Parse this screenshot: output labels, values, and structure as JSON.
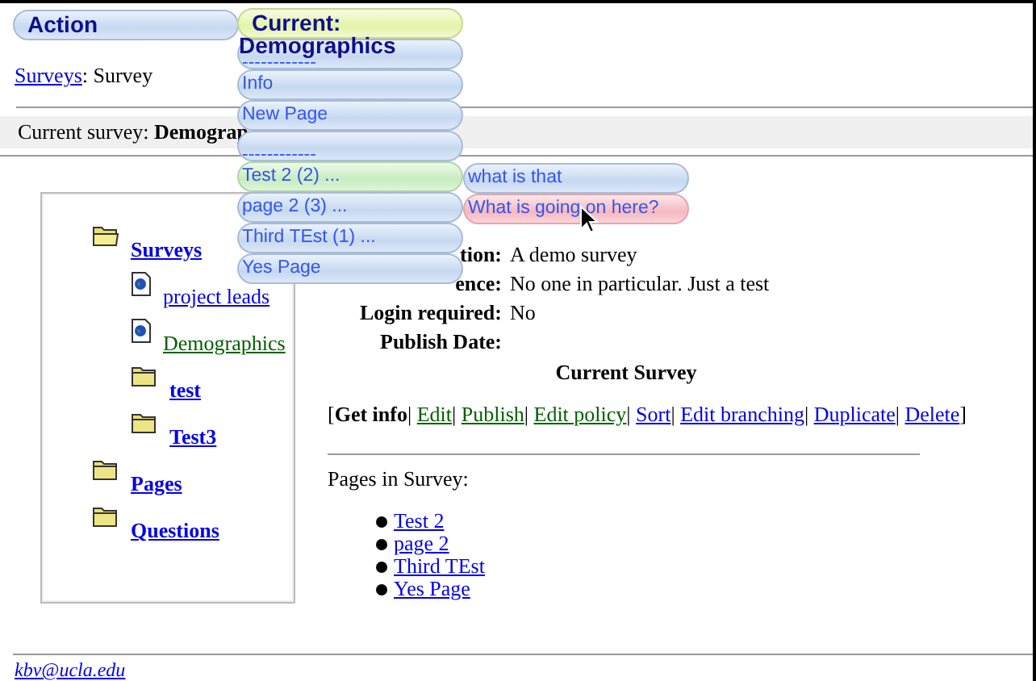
{
  "menubar": [
    {
      "label": "Action"
    }
  ],
  "current_menu": {
    "title": "Current:",
    "subtitle": "Demographics",
    "items": [
      {
        "label": "------------",
        "kind": "separator",
        "expanded": false
      },
      {
        "label": "Info",
        "kind": "item",
        "expanded": false
      },
      {
        "label": "New Page",
        "kind": "item",
        "expanded": false
      },
      {
        "label": "------------",
        "kind": "separator",
        "expanded": false
      },
      {
        "label": "Test 2 (2) ...",
        "kind": "item",
        "expanded": true
      },
      {
        "label": "page 2 (3) ...",
        "kind": "item",
        "expanded": false
      },
      {
        "label": "Third TEst (1) ...",
        "kind": "item",
        "expanded": false
      },
      {
        "label": "Yes Page",
        "kind": "item",
        "expanded": false
      }
    ]
  },
  "submenu": [
    {
      "label": "what is that",
      "selected": false
    },
    {
      "label": "What is going on here?",
      "selected": true
    }
  ],
  "breadcrumb": {
    "link": "Surveys",
    "rest": ": Survey"
  },
  "current_survey": {
    "label": "Current survey: ",
    "value": "Demograp"
  },
  "tree": [
    {
      "label": "Surveys",
      "kind": "folder",
      "expanded": true,
      "selected": false,
      "children": [
        {
          "label": "project leads",
          "kind": "page",
          "selected": false
        },
        {
          "label": "Demographics",
          "kind": "page",
          "selected": true
        },
        {
          "label": "test",
          "kind": "folder",
          "expanded": false,
          "selected": false
        },
        {
          "label": "Test3",
          "kind": "folder",
          "expanded": false,
          "selected": false
        }
      ]
    },
    {
      "label": "Pages",
      "kind": "folder",
      "expanded": false,
      "selected": false
    },
    {
      "label": "Questions",
      "kind": "folder",
      "expanded": false,
      "selected": false
    }
  ],
  "details": [
    {
      "label": "tion:",
      "value": "A demo survey"
    },
    {
      "label": "ence:",
      "value": "No one in particular. Just a test"
    },
    {
      "label": "Login required:",
      "value": "No"
    },
    {
      "label": "Publish Date:"
    }
  ],
  "heading": "Current Survey",
  "actions": {
    "open": "[",
    "close": "]",
    "separator": "|",
    "items": [
      {
        "label": "Get info",
        "kind": "current"
      },
      {
        "label": "Edit",
        "kind": "link",
        "visited": true
      },
      {
        "label": "Publish",
        "kind": "link",
        "visited": true
      },
      {
        "label": "Edit policy",
        "kind": "link",
        "visited": true
      },
      {
        "label": "Sort",
        "kind": "link",
        "visited": false
      },
      {
        "label": "Edit branching",
        "kind": "link",
        "visited": false
      },
      {
        "label": "Duplicate",
        "kind": "link",
        "visited": false
      },
      {
        "label": "Delete",
        "kind": "link",
        "visited": false
      }
    ]
  },
  "pages_label": "Pages in Survey:",
  "pages": [
    "Test 2",
    "page 2",
    "Third TEst",
    "Yes Page"
  ],
  "footer_email": "kbv@ucla.edu"
}
